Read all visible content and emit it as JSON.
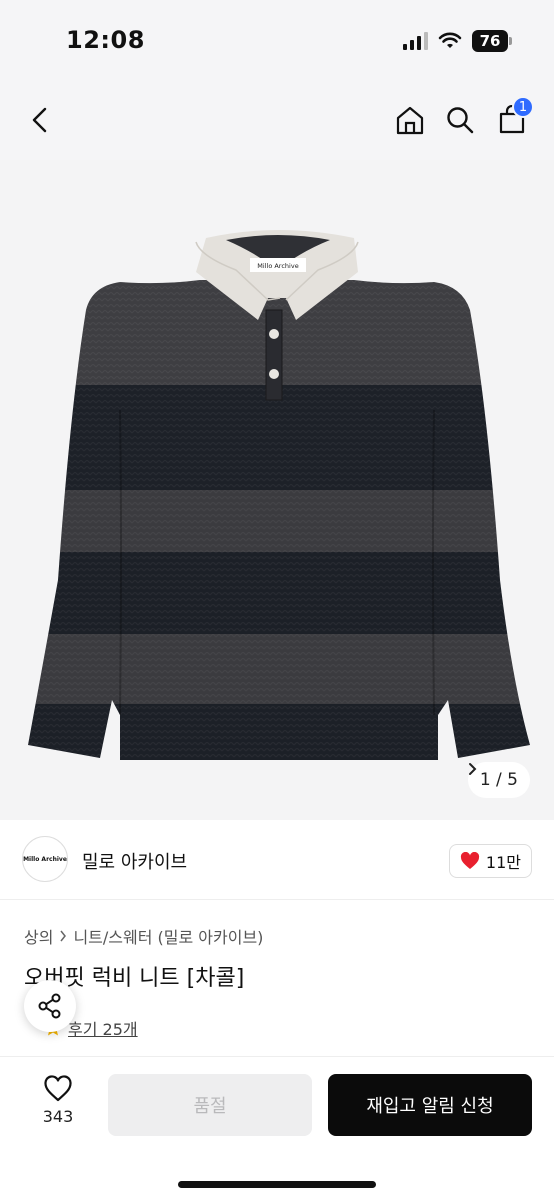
{
  "status_bar": {
    "time": "12:08",
    "battery": "76"
  },
  "nav": {
    "cart_badge": "1"
  },
  "hero": {
    "image_label": "Millo Archive",
    "counter": "1 / 5"
  },
  "brand": {
    "logo_text": "Millo Archive",
    "name": "밀로 아카이브",
    "likes": "11만"
  },
  "breadcrumb": {
    "level1": "상의",
    "level2": "니트/스웨터 (밀로 아카이브)"
  },
  "product": {
    "title": "오버핏 럭비 니트 [차콜]",
    "reviews": "후기 25개"
  },
  "bottom": {
    "wish_count": "343",
    "soldout_label": "품절",
    "restock_label": "재입고 알림 신청"
  },
  "colors": {
    "accent": "#2f6bff",
    "heart": "#e8202e",
    "primary_button": "#0b0b0b"
  }
}
